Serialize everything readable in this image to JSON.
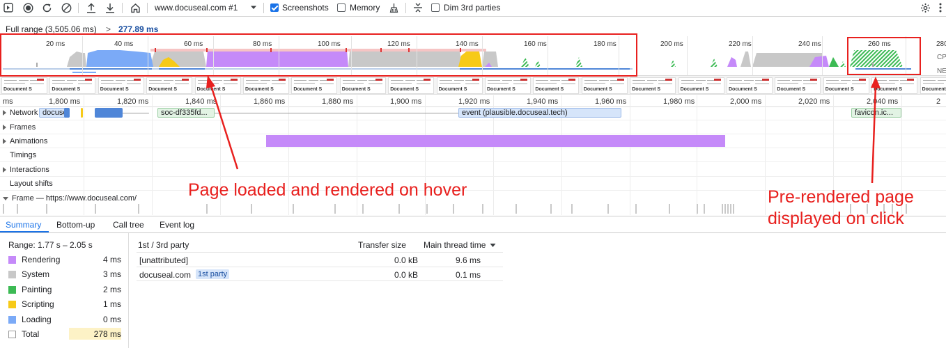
{
  "toolbar": {
    "profile_select": "www.docuseal.com #1",
    "screenshots_label": "Screenshots",
    "screenshots_checked": true,
    "memory_label": "Memory",
    "memory_checked": false,
    "dim_label": "Dim 3rd parties",
    "dim_checked": false
  },
  "breadcrumb": {
    "full_range": "Full range (3,505.06 ms)",
    "separator": ">",
    "current": "277.89 ms"
  },
  "overview": {
    "ticks": [
      "20 ms",
      "40 ms",
      "60 ms",
      "80 ms",
      "100 ms",
      "120 ms",
      "140 ms",
      "160 ms",
      "180 ms",
      "200 ms",
      "220 ms",
      "240 ms",
      "260 ms",
      "280"
    ],
    "side_labels": [
      "CP",
      "NE"
    ]
  },
  "screenshots": {
    "thumb_title": "Document S"
  },
  "ruler": {
    "ticks": [
      "ms",
      "1,800 ms",
      "1,820 ms",
      "1,840 ms",
      "1,860 ms",
      "1,880 ms",
      "1,900 ms",
      "1,920 ms",
      "1,940 ms",
      "1,960 ms",
      "1,980 ms",
      "2,000 ms",
      "2,020 ms",
      "2,040 ms",
      "2"
    ]
  },
  "tracks": {
    "network": "Network",
    "network_request_1": "docuseal",
    "network_request_2": "soc-df335fd...",
    "network_request_3": "event (plausible.docuseal.tech)",
    "network_request_4": "favicon.ic...",
    "frames": "Frames",
    "animations": "Animations",
    "timings": "Timings",
    "interactions": "Interactions",
    "layout_shifts": "Layout shifts",
    "frame": "Frame — https://www.docuseal.com/"
  },
  "bottom_tabs": [
    "Summary",
    "Bottom-up",
    "Call tree",
    "Event log"
  ],
  "summary": {
    "range": "Range: 1.77 s – 2.05 s",
    "rows": [
      {
        "label": "Rendering",
        "value": "4 ms",
        "color": "#c58af9"
      },
      {
        "label": "System",
        "value": "3 ms",
        "color": "#c8c8c8"
      },
      {
        "label": "Painting",
        "value": "2 ms",
        "color": "#3cba54"
      },
      {
        "label": "Scripting",
        "value": "1 ms",
        "color": "#f7ca18"
      },
      {
        "label": "Loading",
        "value": "0 ms",
        "color": "#7baaf7"
      },
      {
        "label": "Total",
        "value": "278 ms",
        "color": "#ffffff"
      }
    ]
  },
  "party_table": {
    "headers": {
      "party": "1st / 3rd party",
      "transfer": "Transfer size",
      "main": "Main thread time"
    },
    "rows": [
      {
        "name": "[unattributed]",
        "badge": "",
        "transfer": "0.0 kB",
        "main": "9.6 ms"
      },
      {
        "name": "docuseal.com",
        "badge": "1st party",
        "transfer": "0.0 kB",
        "main": "0.1 ms"
      }
    ]
  },
  "annotations": {
    "left": "Page loaded and rendered on hover",
    "right_line1": "Pre-rendered page",
    "right_line2": "displayed on click"
  },
  "colors": {
    "annotation": "#e8201e",
    "accent": "#1a73e8",
    "rendering": "#c58af9",
    "system": "#c8c8c8",
    "painting": "#3cba54",
    "scripting": "#f7ca18",
    "loading": "#7baaf7"
  }
}
